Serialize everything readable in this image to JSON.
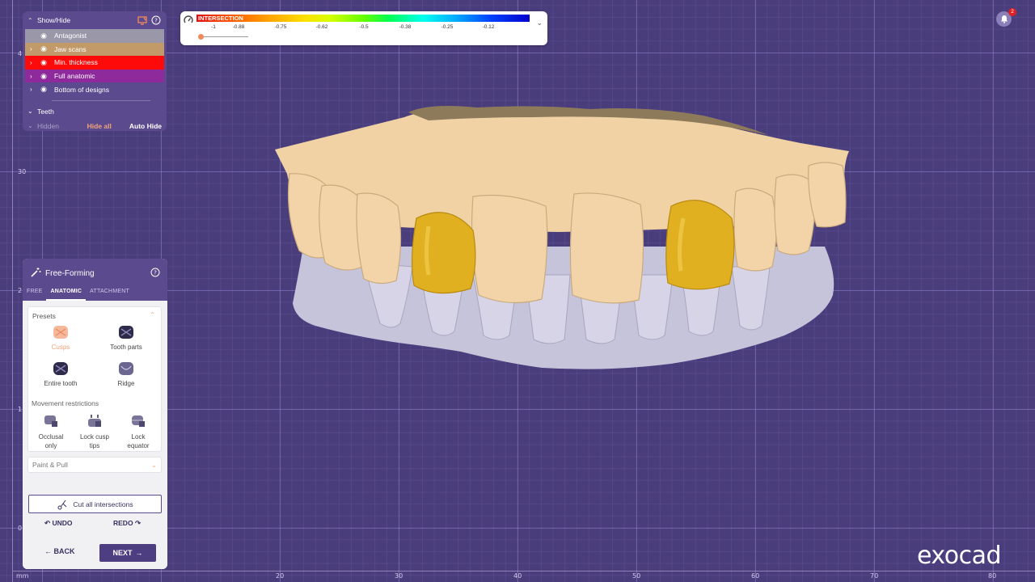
{
  "show_hide": {
    "title": "Show/Hide",
    "items": [
      {
        "label": "Antagonist",
        "color": "#9a98a8"
      },
      {
        "label": "Jaw scans",
        "color": "#c29a6a"
      },
      {
        "label": "Min. thickness",
        "color": "#ff0a0a"
      },
      {
        "label": "Full anatomic",
        "color": "#8e2a9c"
      },
      {
        "label": "Bottom of designs",
        "color": "#5b4a8e"
      }
    ],
    "teeth_label": "Teeth",
    "hidden_label": "Hidden",
    "hide_all_label": "Hide all",
    "auto_hide_label": "Auto Hide"
  },
  "color_scale": {
    "label": "INTERSECTION",
    "ticks": [
      "-1",
      "-0.88",
      "-0.75",
      "-0.62",
      "-0.5",
      "-0.38",
      "-0.25",
      "-0.12"
    ]
  },
  "free_forming": {
    "title": "Free-Forming",
    "tabs": [
      "FREE",
      "ANATOMIC",
      "ATTACHMENT"
    ],
    "active_tab": "ANATOMIC",
    "presets_title": "Presets",
    "presets": [
      "Cusps",
      "Tooth parts",
      "Entire tooth",
      "Ridge"
    ],
    "selected_preset": "Cusps",
    "movement_title": "Movement restrictions",
    "restrictions": [
      {
        "line1": "Occlusal",
        "line2": "only"
      },
      {
        "line1": "Lock cusp",
        "line2": "tips"
      },
      {
        "line1": "Lock",
        "line2": "equator"
      }
    ],
    "paint_pull_label": "Paint & Pull",
    "cut_label": "Cut all intersections",
    "undo_label": "UNDO",
    "redo_label": "REDO",
    "back_label": "BACK",
    "next_label": "NEXT"
  },
  "ruler": {
    "unit": "mm",
    "left_ticks": [
      "4",
      "30",
      "2",
      "1",
      "0"
    ],
    "bottom_ticks": [
      "20",
      "30",
      "40",
      "50",
      "60",
      "70",
      "80"
    ]
  },
  "notifications": {
    "count": "2"
  },
  "brand": {
    "logo": "exocad"
  },
  "colors": {
    "panel_purple": "#5b4a8e",
    "accent_orange": "#f0a47a",
    "gold_crown": "#e0b020",
    "gum_beige": "#f0d2a4",
    "antagonist_grey": "#c6c4da"
  }
}
